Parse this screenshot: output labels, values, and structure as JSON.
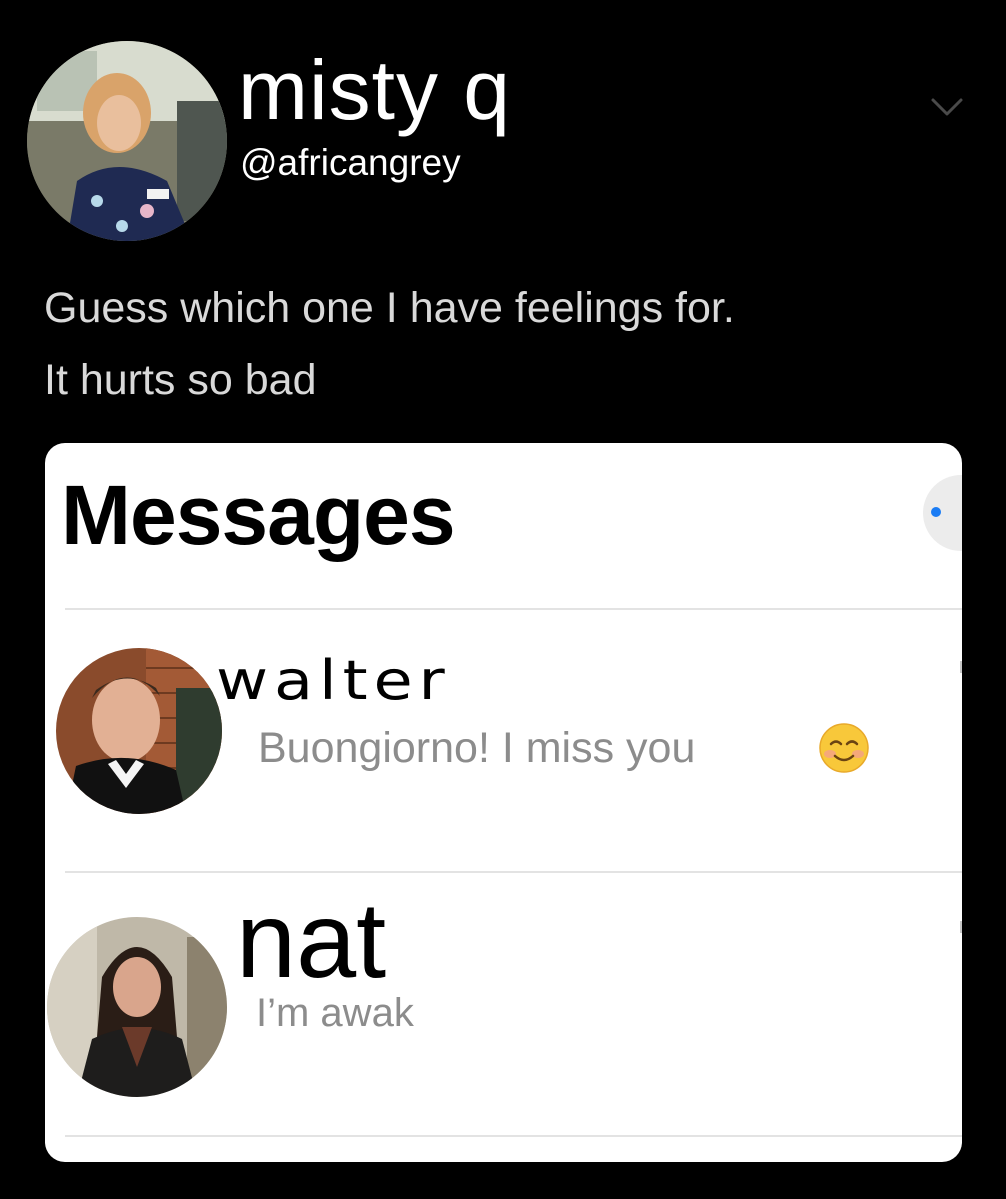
{
  "tweet": {
    "display_name": "misty q",
    "handle": "@africangrey",
    "text_lines": [
      "Guess which one I have feelings for.",
      "It hurts so bad"
    ],
    "menu_icon": "chevron-down-icon"
  },
  "messages": {
    "title": "Messages",
    "action_icon": "compose-icon",
    "accent_color": "#1a7cf4",
    "conversations": [
      {
        "name": "walter",
        "preview": "Buongiorno! I miss you",
        "emoji": "smiling-face-with-smiling-eyes"
      },
      {
        "name": "nat",
        "preview": "I’m awak"
      }
    ]
  }
}
